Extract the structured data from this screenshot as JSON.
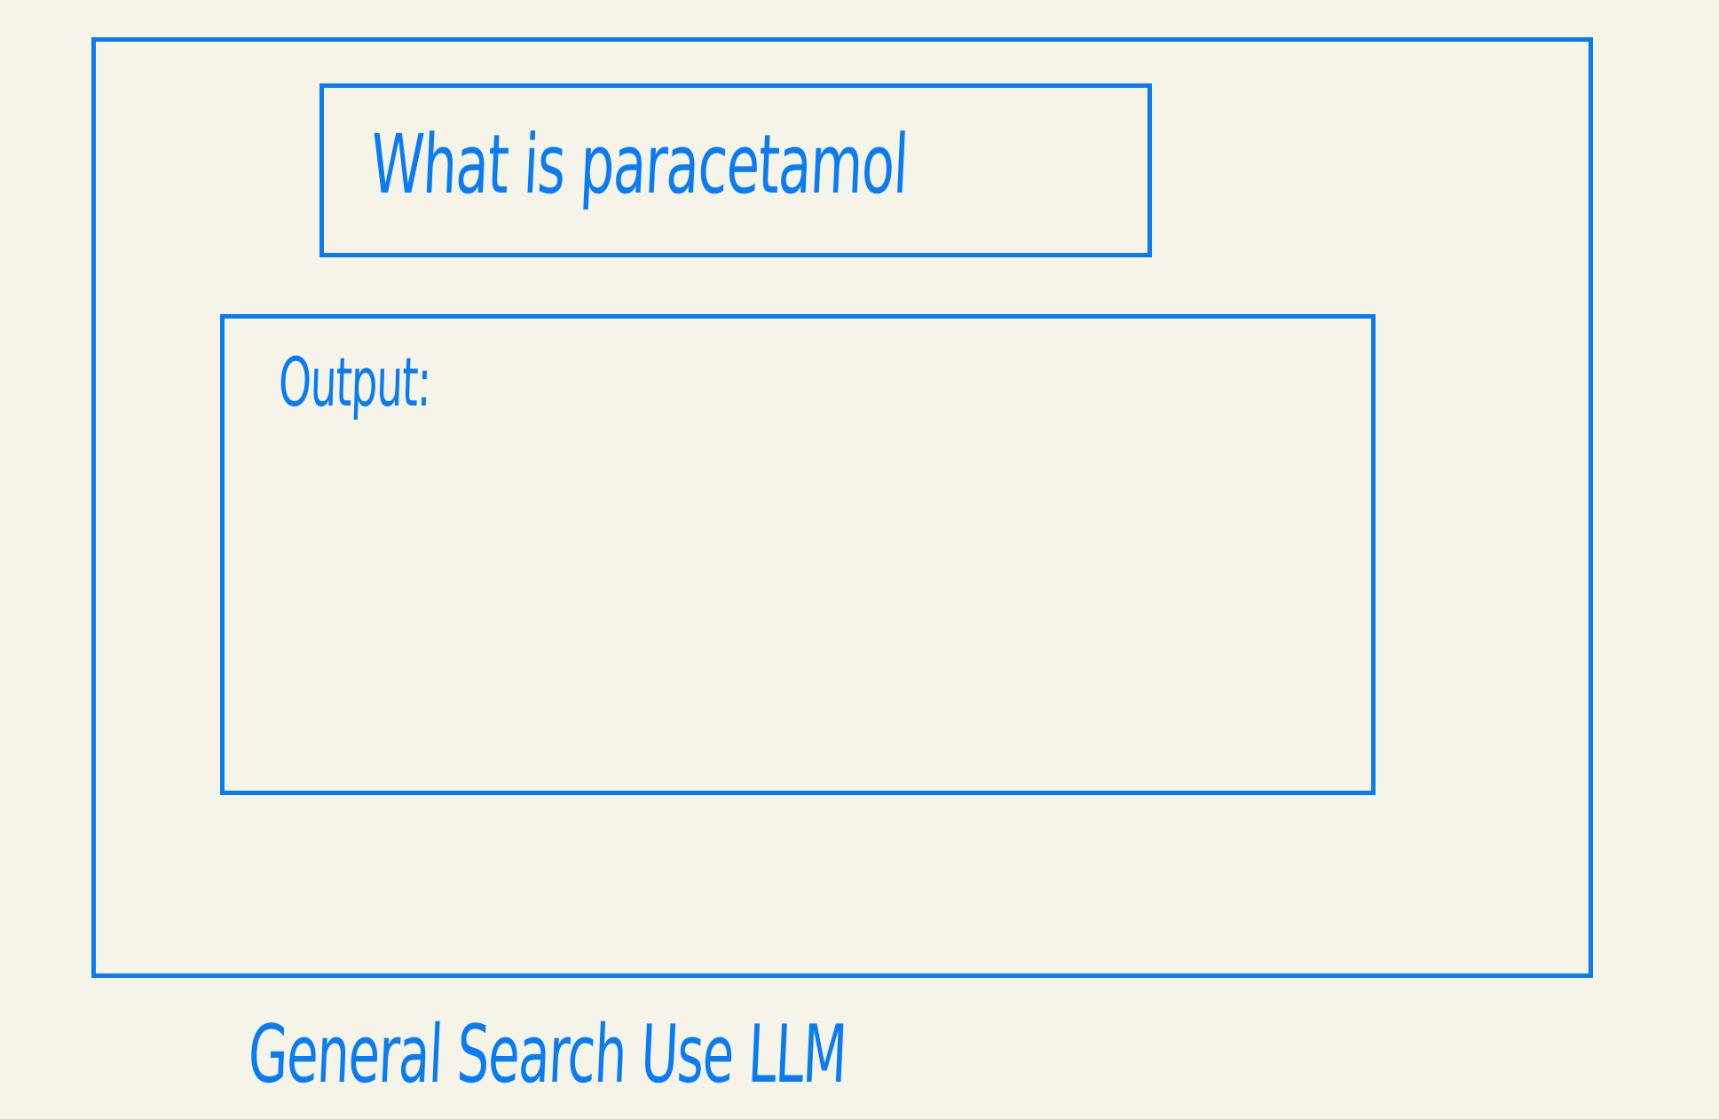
{
  "query_box": {
    "text": "What is paracetamol"
  },
  "output_panel": {
    "label": "Output:",
    "content": ""
  },
  "caption": {
    "text": "General Search Use LLM"
  },
  "colors": {
    "stroke": "#0a7cf3",
    "background": "#f6f4e8"
  }
}
